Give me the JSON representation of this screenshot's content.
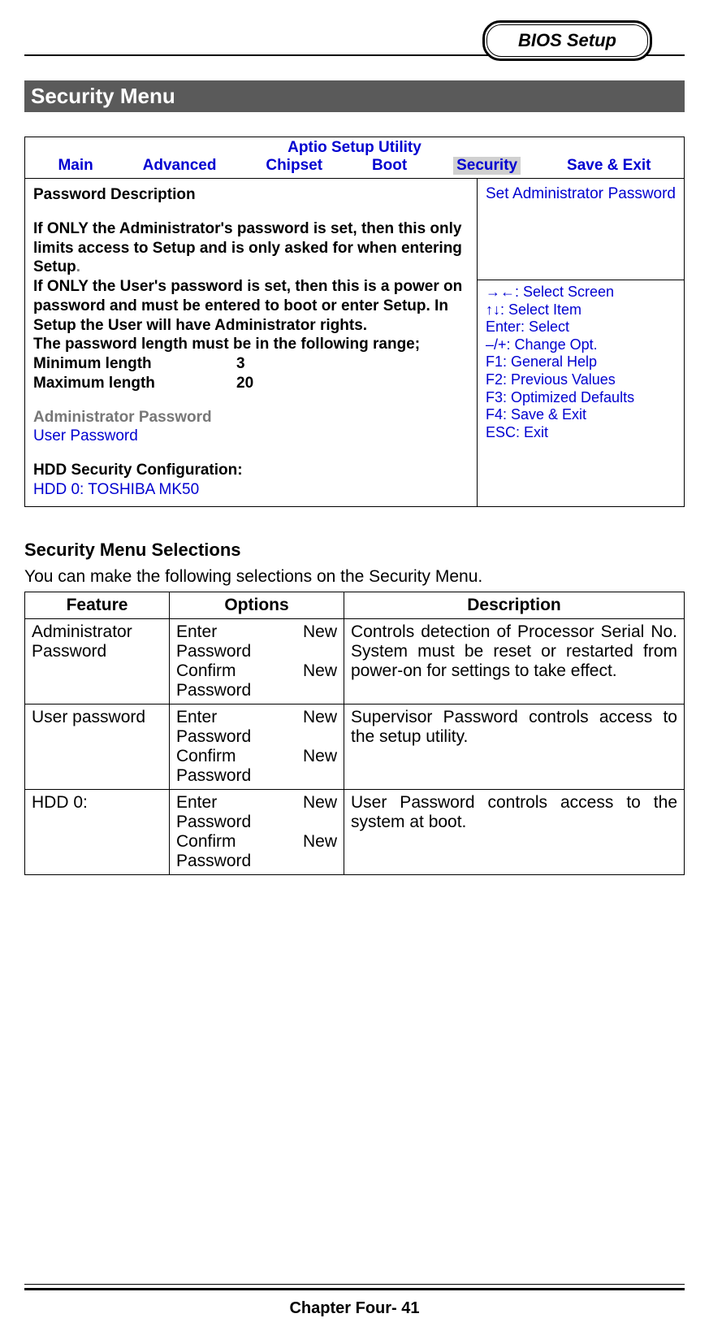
{
  "header": {
    "title": "BIOS Setup"
  },
  "section_bar": "Security Menu",
  "bios": {
    "title": "Aptio Setup Utility",
    "tabs": {
      "main": "Main",
      "advanced": "Advanced",
      "chipset": "Chipset",
      "boot": "Boot",
      "security": "Security",
      "saveexit": "Save & Exit"
    },
    "left": {
      "pw_desc_heading": "Password Description",
      "admin_only": "If ONLY the Administrator's password is set, then this only limits access to Setup and is only asked for when entering Setup",
      "period": ".",
      "user_only": "If ONLY the User's password is set, then this is a power on password and must be entered to boot or enter Setup. In Setup the User will have Administrator rights.",
      "length_line": "The password length must be in the following range;",
      "min_label": "Minimum length",
      "min_val": "3",
      "max_label": "Maximum length",
      "max_val": "20",
      "admin_pw": "Administrator Password",
      "user_pw": "User Password",
      "hdd_conf": "HDD Security Configuration:",
      "hdd0": "HDD 0: TOSHIBA MK50"
    },
    "right": {
      "help": "Set Administrator Password",
      "nav": {
        "l1": "→←: Select Screen",
        "l2": "↑↓: Select Item",
        "l3": "Enter: Select",
        "l4": "–/+: Change Opt.",
        "l5": "F1: General Help",
        "l6": "F2: Previous Values",
        "l7": "F3: Optimized Defaults",
        "l8": "F4: Save & Exit",
        "l9": "ESC: Exit"
      }
    }
  },
  "selections": {
    "heading": "Security Menu Selections",
    "intro": "You can make the following selections on the Security Menu.",
    "columns": {
      "feature": "Feature",
      "options": "Options",
      "description": "Description"
    },
    "rows": [
      {
        "feature": "Administrator Password",
        "opt1": "Enter New",
        "opt2": "Password",
        "opt3": "Confirm New",
        "opt4": "Password",
        "desc": "Controls detection of Processor Serial No. System must be reset or restarted from power-on for settings to take effect."
      },
      {
        "feature": "User password",
        "opt1": "Enter New",
        "opt2": "Password",
        "opt3": "Confirm New",
        "opt4": "Password",
        "desc": "Supervisor Password controls access to the setup utility."
      },
      {
        "feature": "HDD 0:",
        "opt1": "Enter New",
        "opt2": "Password",
        "opt3": "Confirm New",
        "opt4": "Password",
        "desc": "User Password controls access to the system at boot."
      }
    ]
  },
  "footer": {
    "text": "Chapter Four- 41"
  }
}
